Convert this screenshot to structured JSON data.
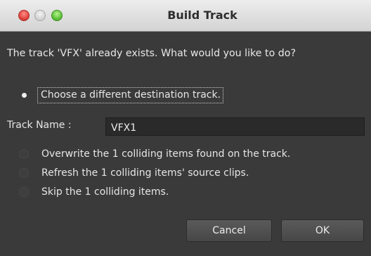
{
  "window": {
    "title": "Build Track"
  },
  "message": "The track 'VFX' already exists.  What would you like to do?",
  "options": [
    {
      "label": "Choose a different destination track.",
      "checked": true
    },
    {
      "label": "Overwrite the 1 colliding items found on the track.",
      "checked": false
    },
    {
      "label": "Refresh the 1 colliding items' source clips.",
      "checked": false
    },
    {
      "label": "Skip the 1 colliding items.",
      "checked": false
    }
  ],
  "track_name": {
    "label": "Track Name :",
    "value": "VFX1"
  },
  "buttons": {
    "cancel": "Cancel",
    "ok": "OK"
  }
}
